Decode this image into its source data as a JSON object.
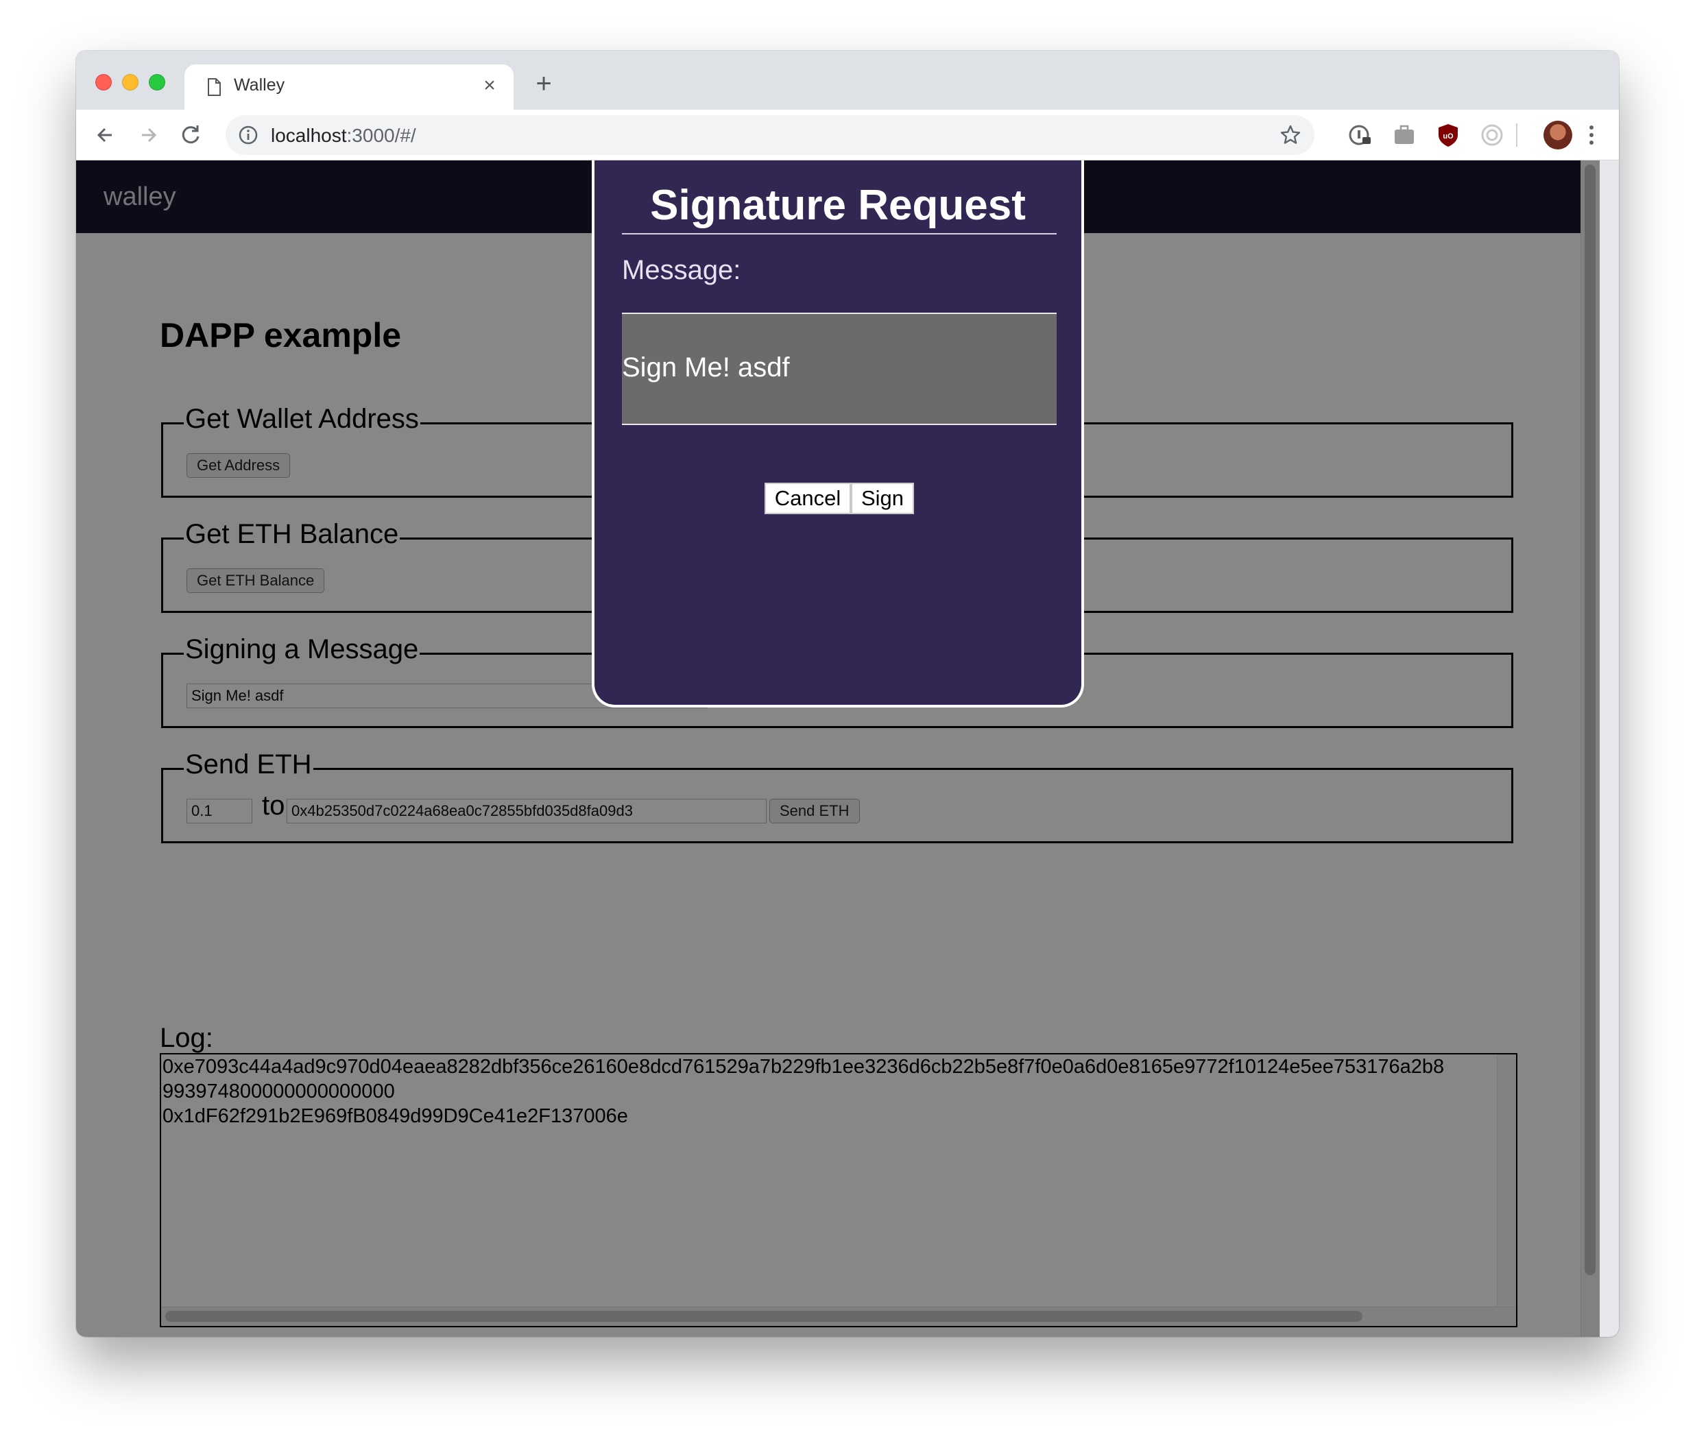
{
  "browser": {
    "tab_title": "Walley",
    "url_host": "localhost",
    "url_rest": ":3000/#/"
  },
  "app": {
    "brand": "walley",
    "page_title": "DAPP example"
  },
  "sections": {
    "wallet_address": {
      "legend": "Get Wallet Address",
      "button": "Get Address"
    },
    "eth_balance": {
      "legend": "Get ETH Balance",
      "button": "Get ETH Balance"
    },
    "signing": {
      "legend": "Signing a Message",
      "input_value": "Sign Me! asdf"
    },
    "send_eth": {
      "legend": "Send ETH",
      "amount_value": "0.1",
      "to_label": "to",
      "address_value": "0x4b25350d7c0224a68ea0c72855bfd035d8fa09d3",
      "button": "Send ETH"
    }
  },
  "log": {
    "label": "Log:",
    "lines": [
      "0xe7093c44a4ad9c970d04eaea8282dbf356ce26160e8dcd761529a7b229fb1ee3236d6cb22b5e8f7f0e0a6d0e8165e9772f10124e5ee753176a2b8",
      "993974800000000000000",
      "0x1dF62f291b2E969fB0849d99D9Ce41e2F137006e"
    ]
  },
  "modal": {
    "title": "Signature Request",
    "message_label": "Message:",
    "message_text": "Sign Me! asdf",
    "cancel_label": "Cancel",
    "sign_label": "Sign"
  },
  "colors": {
    "navbar_bg": "#1b1530",
    "modal_bg": "#312752",
    "message_box_bg": "#6b6b6b"
  }
}
